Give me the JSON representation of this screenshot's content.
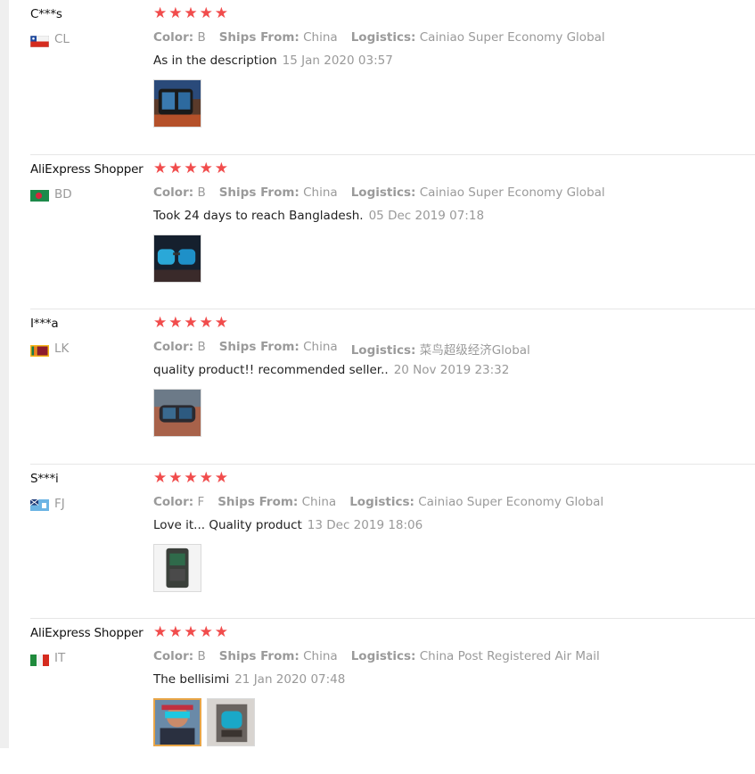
{
  "reviews": [
    {
      "user": "C***s",
      "country": "CL",
      "flag": "chile-flag-icon",
      "rating": 5,
      "color_label": "Color:",
      "color": "B",
      "ships_label": "Ships From:",
      "ships": "China",
      "logistics_label": "Logistics:",
      "logistics": "Cainiao Super Economy Global",
      "text": "As in the description",
      "date": "15 Jan 2020 03:57",
      "photos": 1
    },
    {
      "user": "AliExpress Shopper",
      "country": "BD",
      "flag": "bangladesh-flag-icon",
      "rating": 5,
      "color_label": "Color:",
      "color": "B",
      "ships_label": "Ships From:",
      "ships": "China",
      "logistics_label": "Logistics:",
      "logistics": "Cainiao Super Economy Global",
      "text": "Took 24 days to reach Bangladesh.",
      "date": "05 Dec 2019 07:18",
      "photos": 1
    },
    {
      "user": "I***a",
      "country": "LK",
      "flag": "sri-lanka-flag-icon",
      "rating": 5,
      "color_label": "Color:",
      "color": "B",
      "ships_label": "Ships From:",
      "ships": "China",
      "logistics_label": "Logistics:",
      "logistics": "菜鸟超级经济Global",
      "text": "quality product!! recommended seller..",
      "date": "20 Nov 2019 23:32",
      "photos": 1
    },
    {
      "user": "S***i",
      "country": "FJ",
      "flag": "fiji-flag-icon",
      "rating": 5,
      "color_label": "Color:",
      "color": "F",
      "ships_label": "Ships From:",
      "ships": "China",
      "logistics_label": "Logistics:",
      "logistics": "Cainiao Super Economy Global",
      "text": "Love it... Quality product",
      "date": "13 Dec 2019 18:06",
      "photos": 1
    },
    {
      "user": "AliExpress Shopper",
      "country": "IT",
      "flag": "italy-flag-icon",
      "rating": 5,
      "color_label": "Color:",
      "color": "B",
      "ships_label": "Ships From:",
      "ships": "China",
      "logistics_label": "Logistics:",
      "logistics": "China Post Registered Air Mail",
      "text": "The bellisimi",
      "date": "21 Jan 2020 07:48",
      "photos": 2
    }
  ],
  "star_color": "#f14c4c",
  "star_icon": "star-icon"
}
